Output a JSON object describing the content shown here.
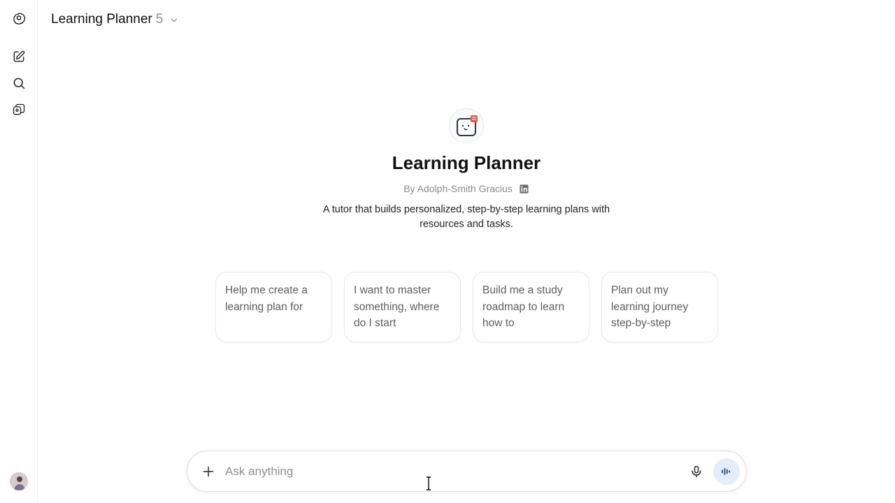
{
  "header": {
    "title": "Learning Planner",
    "version": "5",
    "dropdown_icon": "chevron-down-icon"
  },
  "sidebar": {
    "items": [
      {
        "name": "openai-logo-icon"
      },
      {
        "name": "new-chat-icon"
      },
      {
        "name": "search-icon"
      },
      {
        "name": "gpts-library-icon"
      }
    ],
    "avatar": "user-avatar"
  },
  "gpt": {
    "name": "Learning Planner",
    "author": "By Adolph-Smith Gracius",
    "author_link_icon": "linkedin-icon",
    "description": "A tutor that builds personalized, step-by-step learning plans with resources and tasks."
  },
  "starters": [
    {
      "text": "Help me create a learning plan for"
    },
    {
      "text": "I want to master something, where do I start"
    },
    {
      "text": "Build me a study roadmap to learn how to"
    },
    {
      "text": "Plan out my learning journey step-by-step"
    }
  ],
  "composer": {
    "placeholder": "Ask anything",
    "value": "",
    "plus_icon": "plus-icon",
    "mic_icon": "microphone-icon",
    "voice_icon": "voice-mode-icon"
  },
  "colors": {
    "accent_voice_bg": "#e3eefc",
    "text_primary": "#0d0d0d",
    "text_muted": "#8f8f8f"
  }
}
